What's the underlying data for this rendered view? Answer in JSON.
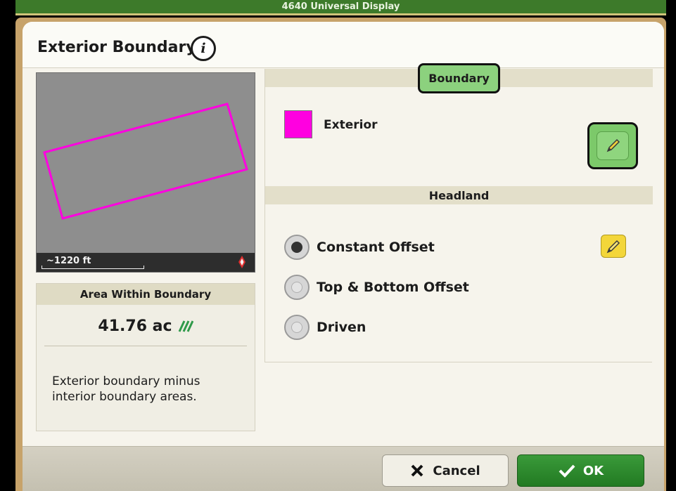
{
  "app": {
    "title": "4640 Universal Display"
  },
  "dialog": {
    "title": "Exterior Boundary",
    "info_icon": "info-icon",
    "info_glyph": "i"
  },
  "map": {
    "scale_label": "~1220 ft",
    "boundary_color": "#ff00e0",
    "compass_icon": "north-arrow-icon"
  },
  "area": {
    "header": "Area Within Boundary",
    "value": "41.76 ac",
    "icon": "hatch-area-icon",
    "description": "Exterior boundary minus interior boundary areas."
  },
  "boundary_section": {
    "tab_label": "Boundary",
    "items": [
      {
        "label": "Exterior",
        "color": "#ff00e0",
        "edit_icon": "pencil-icon"
      }
    ]
  },
  "headland_section": {
    "label": "Headland",
    "options": [
      {
        "label": "Constant Offset",
        "selected": true
      },
      {
        "label": "Top & Bottom Offset",
        "selected": false
      },
      {
        "label": "Driven",
        "selected": false
      }
    ],
    "edit_icon": "pencil-icon"
  },
  "footer": {
    "cancel_label": "Cancel",
    "ok_label": "OK",
    "cancel_icon": "x-icon",
    "ok_icon": "checkmark-icon"
  },
  "colors": {
    "brand_green": "#3d7a2a",
    "highlight_green": "#8cd17e",
    "ok_green": "#2f8c2f",
    "edit_yellow": "#f3d63a"
  }
}
